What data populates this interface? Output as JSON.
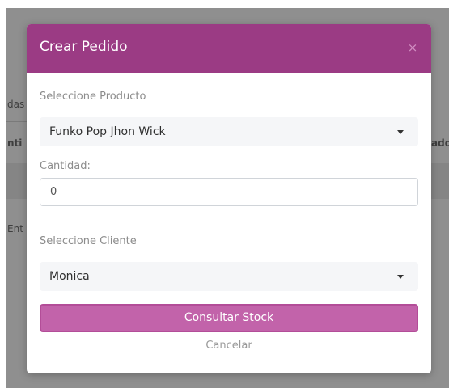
{
  "background": {
    "fragments": [
      "das",
      "nti",
      "ado",
      "Ent"
    ]
  },
  "modal": {
    "title": "Crear Pedido",
    "close_symbol": "×",
    "product": {
      "label": "Seleccione Producto",
      "selected": "Funko Pop Jhon Wick",
      "icon": "caret-down-icon"
    },
    "quantity": {
      "label": "Cantidad:",
      "value": "0"
    },
    "client": {
      "label": "Seleccione Cliente",
      "selected": "Monica",
      "icon": "caret-down-icon"
    },
    "submit_label": "Consultar Stock",
    "cancel_label": "Cancelar"
  },
  "colors": {
    "header": "#9b3b84",
    "primary_button": "#c263aa",
    "overlay": "#8f8f8f"
  }
}
